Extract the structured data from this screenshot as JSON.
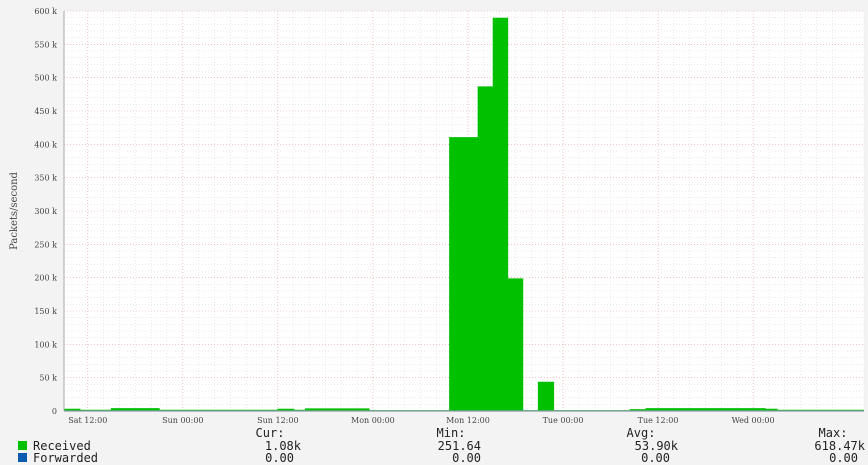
{
  "chart_data": {
    "type": "area",
    "ylabel": "Packets/second",
    "ylim": [
      0,
      600000
    ],
    "y_ticks": [
      {
        "v": 0,
        "label": "0"
      },
      {
        "v": 50000,
        "label": "50 k"
      },
      {
        "v": 100000,
        "label": "100 k"
      },
      {
        "v": 150000,
        "label": "150 k"
      },
      {
        "v": 200000,
        "label": "200 k"
      },
      {
        "v": 250000,
        "label": "250 k"
      },
      {
        "v": 300000,
        "label": "300 k"
      },
      {
        "v": 350000,
        "label": "350 k"
      },
      {
        "v": 400000,
        "label": "400 k"
      },
      {
        "v": 450000,
        "label": "450 k"
      },
      {
        "v": 500000,
        "label": "500 k"
      },
      {
        "v": 550000,
        "label": "550 k"
      },
      {
        "v": 600000,
        "label": "600 k"
      }
    ],
    "xlim_hours": [
      -15,
      86
    ],
    "x_ticks": [
      {
        "h": -12,
        "label": "Sat 12:00"
      },
      {
        "h": 0,
        "label": "Sun 00:00"
      },
      {
        "h": 12,
        "label": "Sun 12:00"
      },
      {
        "h": 24,
        "label": "Mon 00:00"
      },
      {
        "h": 36,
        "label": "Mon 12:00"
      },
      {
        "h": 48,
        "label": "Tue 00:00"
      },
      {
        "h": 60,
        "label": "Tue 12:00"
      },
      {
        "h": 72,
        "label": "Wed 00:00"
      }
    ],
    "grid": true,
    "series": [
      {
        "name": "Received",
        "color": "#00c000",
        "points": [
          [
            -15,
            2500
          ],
          [
            -13,
            2500
          ],
          [
            -13,
            1000
          ],
          [
            -9,
            1000
          ],
          [
            -9,
            3500
          ],
          [
            -3,
            3500
          ],
          [
            -3,
            1000
          ],
          [
            12,
            1000
          ],
          [
            12,
            2500
          ],
          [
            14,
            2500
          ],
          [
            14,
            1000
          ],
          [
            15.5,
            1000
          ],
          [
            15.5,
            3000
          ],
          [
            23.5,
            3000
          ],
          [
            23.5,
            500
          ],
          [
            33.7,
            500
          ],
          [
            33.7,
            410000
          ],
          [
            37.3,
            410000
          ],
          [
            37.3,
            486000
          ],
          [
            39.2,
            486000
          ],
          [
            39.2,
            589000
          ],
          [
            41,
            589000
          ],
          [
            41,
            198000
          ],
          [
            42.9,
            198000
          ],
          [
            42.9,
            500
          ],
          [
            44.9,
            500
          ],
          [
            44.9,
            43000
          ],
          [
            46.8,
            43000
          ],
          [
            46.8,
            500
          ],
          [
            56.5,
            500
          ],
          [
            56.5,
            2000
          ],
          [
            58.5,
            2000
          ],
          [
            58.5,
            3500
          ],
          [
            73.5,
            3500
          ],
          [
            73.5,
            2500
          ],
          [
            75,
            2500
          ],
          [
            75,
            1000
          ],
          [
            86,
            1000
          ]
        ]
      },
      {
        "name": "Forwarded",
        "color": "#0a5dae",
        "points": [
          [
            -15,
            0
          ],
          [
            86,
            0
          ]
        ]
      }
    ]
  },
  "legend": {
    "headers": {
      "cur": "Cur:",
      "min": "Min:",
      "avg": "Avg:",
      "max": "Max:"
    },
    "rows": [
      {
        "label": "Received",
        "color": "#00c000",
        "cur": "1.08k",
        "min": "251.64",
        "avg": "53.90k",
        "max": "618.47k"
      },
      {
        "label": "Forwarded",
        "color": "#0a5dae",
        "cur": "0.00",
        "min": "0.00",
        "avg": "0.00",
        "max": "0.00"
      }
    ]
  }
}
